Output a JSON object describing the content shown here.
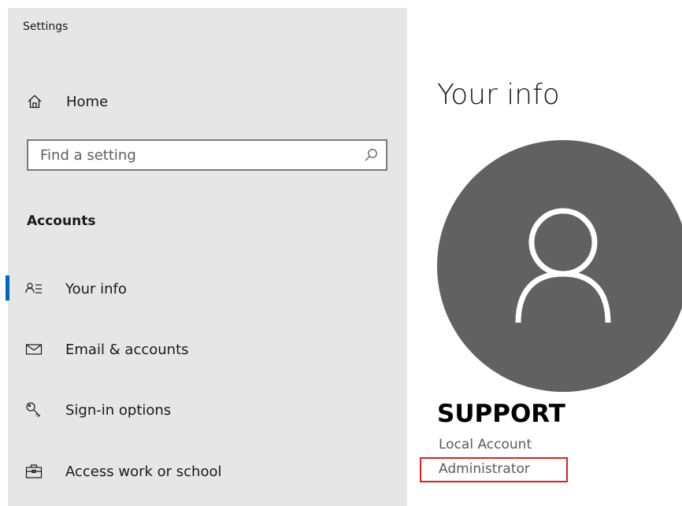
{
  "app": {
    "title": "Settings"
  },
  "sidebar": {
    "home": {
      "label": "Home",
      "icon": "home-icon"
    },
    "search": {
      "placeholder": "Find a setting",
      "value": "",
      "icon": "search-icon"
    },
    "section_title": "Accounts",
    "items": [
      {
        "label": "Your info",
        "icon": "person-list-icon",
        "active": true
      },
      {
        "label": "Email & accounts",
        "icon": "envelope-icon",
        "active": false
      },
      {
        "label": "Sign-in options",
        "icon": "key-icon",
        "active": false
      },
      {
        "label": "Access work or school",
        "icon": "briefcase-icon",
        "active": false
      }
    ]
  },
  "main": {
    "title": "Your info",
    "avatar_icon": "person-icon",
    "user_name": "SUPPORT",
    "account_type": "Local Account",
    "account_role": "Administrator"
  },
  "colors": {
    "accent": "#0067c0",
    "sidebar_bg": "#e6e6e6",
    "avatar_bg": "#616161",
    "highlight_border": "#e02020"
  }
}
